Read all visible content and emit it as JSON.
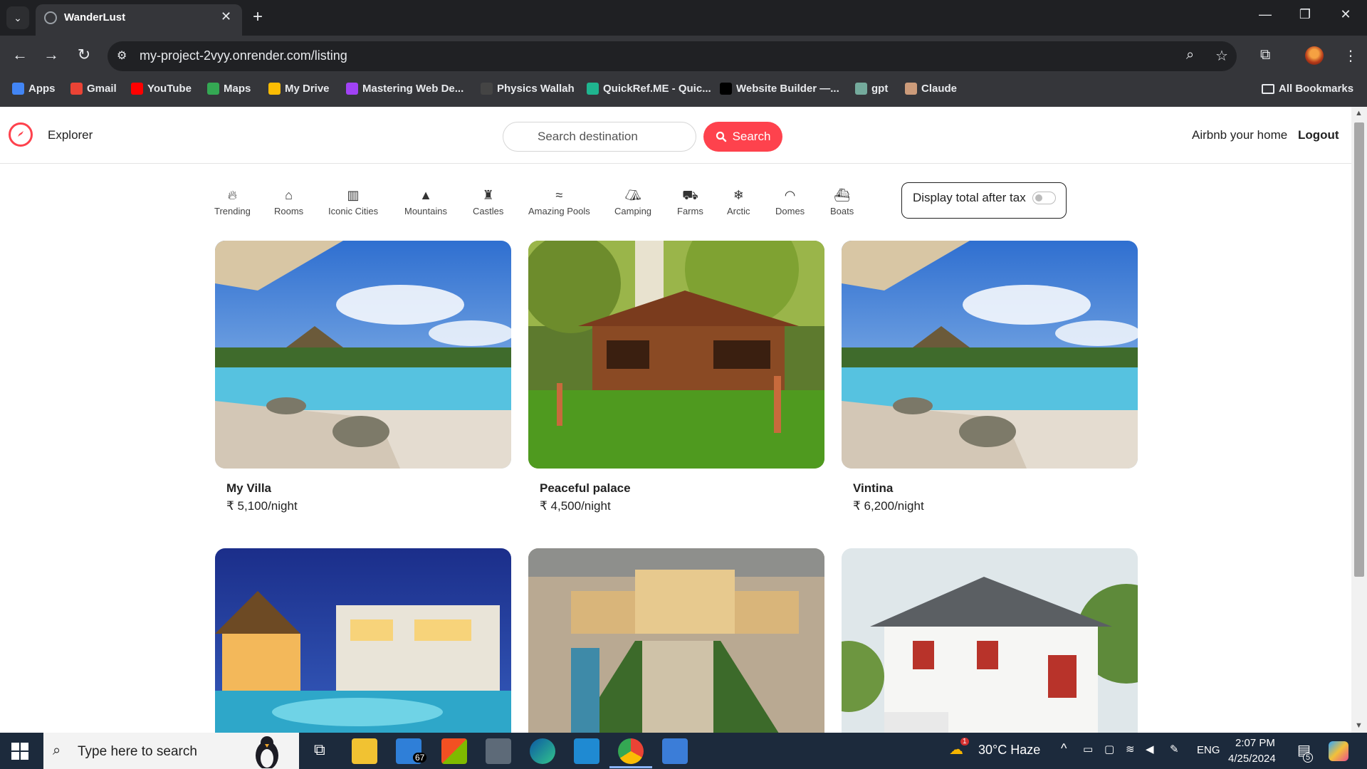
{
  "browser": {
    "tab_title": "WanderLust",
    "url": "my-project-2vyy.onrender.com/listing",
    "bookmarks": [
      {
        "label": "Apps",
        "icon": "apps-grid-icon",
        "color": "#4285f4"
      },
      {
        "label": "Gmail",
        "icon": "gmail-icon",
        "color": "#ea4335"
      },
      {
        "label": "YouTube",
        "icon": "youtube-icon",
        "color": "#ff0000"
      },
      {
        "label": "Maps",
        "icon": "maps-icon",
        "color": "#34a853"
      },
      {
        "label": "My Drive",
        "icon": "drive-icon",
        "color": "#fbbc04"
      },
      {
        "label": "Mastering Web De...",
        "icon": "course-icon",
        "color": "#a142f4"
      },
      {
        "label": "Physics Wallah",
        "icon": "pw-icon",
        "color": "#444444"
      },
      {
        "label": "QuickRef.ME - Quic...",
        "icon": "quickref-icon",
        "color": "#1fb58f"
      },
      {
        "label": "Website Builder —...",
        "icon": "web-builder-icon",
        "color": "#000000"
      },
      {
        "label": "gpt",
        "icon": "openai-icon",
        "color": "#74aa9c"
      },
      {
        "label": "Claude",
        "icon": "claude-icon",
        "color": "#cc9b7a"
      }
    ],
    "all_bookmarks": "All Bookmarks"
  },
  "navbar": {
    "brand": "Explorer",
    "search_placeholder": "Search destination",
    "search_button": "Search",
    "host_link": "Airbnb your home",
    "logout": "Logout",
    "accent": "#fe424d"
  },
  "filters": [
    {
      "label": "Trending",
      "icon": "fire-icon"
    },
    {
      "label": "Rooms",
      "icon": "bed-icon"
    },
    {
      "label": "Iconic Cities",
      "icon": "city-icon"
    },
    {
      "label": "Mountains",
      "icon": "mountain-icon"
    },
    {
      "label": "Castles",
      "icon": "castle-icon"
    },
    {
      "label": "Amazing Pools",
      "icon": "pool-icon"
    },
    {
      "label": "Camping",
      "icon": "campground-icon"
    },
    {
      "label": "Farms",
      "icon": "tractor-icon"
    },
    {
      "label": "Arctic",
      "icon": "snowflake-icon"
    },
    {
      "label": "Domes",
      "icon": "igloo-icon"
    },
    {
      "label": "Boats",
      "icon": "ship-icon"
    }
  ],
  "tax_toggle": {
    "label": "Display total after tax",
    "enabled": false
  },
  "listings": [
    {
      "title": "My Villa",
      "price": "₹ 5,100/night",
      "image": "resort-pool-photo"
    },
    {
      "title": "Peaceful palace",
      "price": "₹ 4,500/night",
      "image": "wooden-house-garden-photo"
    },
    {
      "title": "Vintina",
      "price": "₹ 6,200/night",
      "image": "resort-pool-photo"
    },
    {
      "title": "",
      "price": "",
      "image": "night-resort-photo"
    },
    {
      "title": "",
      "price": "",
      "image": "palace-aerial-photo"
    },
    {
      "title": "",
      "price": "",
      "image": "white-villa-photo"
    }
  ],
  "taskbar": {
    "search_placeholder": "Type here to search",
    "mail_badge": "67",
    "weather": "30°C  Haze",
    "language": "ENG",
    "time": "2:07 PM",
    "date": "4/25/2024",
    "notification_count": "5",
    "weather_alert": "1"
  }
}
